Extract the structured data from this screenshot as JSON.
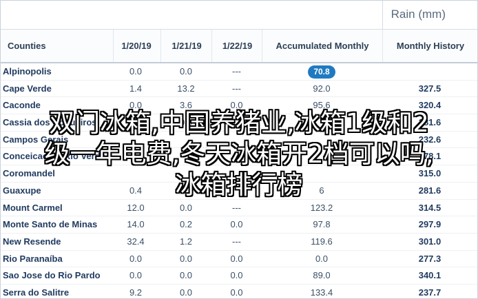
{
  "table": {
    "group_header": "Rain (mm)",
    "columns": [
      "Counties",
      "1/20/19",
      "1/21/19",
      "1/22/19",
      "Accumulated Monthly",
      "Monthly History"
    ],
    "rows": [
      {
        "name": "Alpinopolis",
        "d1": "0.0",
        "d2": "0.0",
        "d3": "---",
        "acc": "70.8",
        "acc_highlight": true,
        "hist": ""
      },
      {
        "name": "Cape Verde",
        "d1": "1.4",
        "d2": "13.2",
        "d3": "---",
        "acc": "92.0",
        "hist": "327.5"
      },
      {
        "name": "Caconde",
        "d1": "0.0",
        "d2": "3.6",
        "d3": "0.0",
        "acc": "95.6",
        "hist": "320.4"
      },
      {
        "name": "Cassia dos Coqueiros",
        "d1": "0.0",
        "d2": "0.0",
        "d3": "0.0",
        "acc": "",
        "hist": "281.6"
      },
      {
        "name": "Campos Gerais",
        "d1": "",
        "d2": "",
        "d3": "",
        "acc": "",
        "hist": "232.6"
      },
      {
        "name": "Conceicao do Rio Verde",
        "d1": "",
        "d2": "",
        "d3": "",
        "acc": "",
        "hist": "278.1"
      },
      {
        "name": "Coromandel",
        "d1": "",
        "d2": "",
        "d3": "",
        "acc": "",
        "hist": "315.0"
      },
      {
        "name": "Guaxupe",
        "d1": "0.4",
        "d2": "",
        "d3": "",
        "acc": "6",
        "hist": "281.6"
      },
      {
        "name": "Mount Carmel",
        "d1": "12.0",
        "d2": "0.0",
        "d3": "---",
        "acc": "123.2",
        "hist": "314.5"
      },
      {
        "name": "Monte Santo de Minas",
        "d1": "14.0",
        "d2": "0.2",
        "d3": "0.0",
        "acc": "97.8",
        "hist": "297.9"
      },
      {
        "name": "New Resende",
        "d1": "32.4",
        "d2": "1.2",
        "d3": "---",
        "acc": "119.6",
        "hist": "301.0"
      },
      {
        "name": "Rio Paranaíba",
        "d1": "0.0",
        "d2": "0.0",
        "d3": "0.0",
        "acc": "0.0",
        "hist": "277.3"
      },
      {
        "name": "Sao Jose do Rio Pardo",
        "d1": "0.0",
        "d2": "0.0",
        "d3": "0.0",
        "acc": "89.0",
        "hist": "340.1"
      },
      {
        "name": "Serra do Salitre",
        "d1": "9.2",
        "d2": "0.0",
        "d3": "0.0",
        "acc": "133.4",
        "hist": "237.7"
      }
    ]
  },
  "overlay": {
    "line1": "双门冰箱,中国养猪业,冰箱1级和2",
    "line2": "级一年电费,冬天冰箱开2档可以吗,",
    "line3": "冰箱排行榜"
  },
  "colors": {
    "accent": "#1f7ac1",
    "text": "#1f3a5f",
    "border": "#c9d1da"
  }
}
